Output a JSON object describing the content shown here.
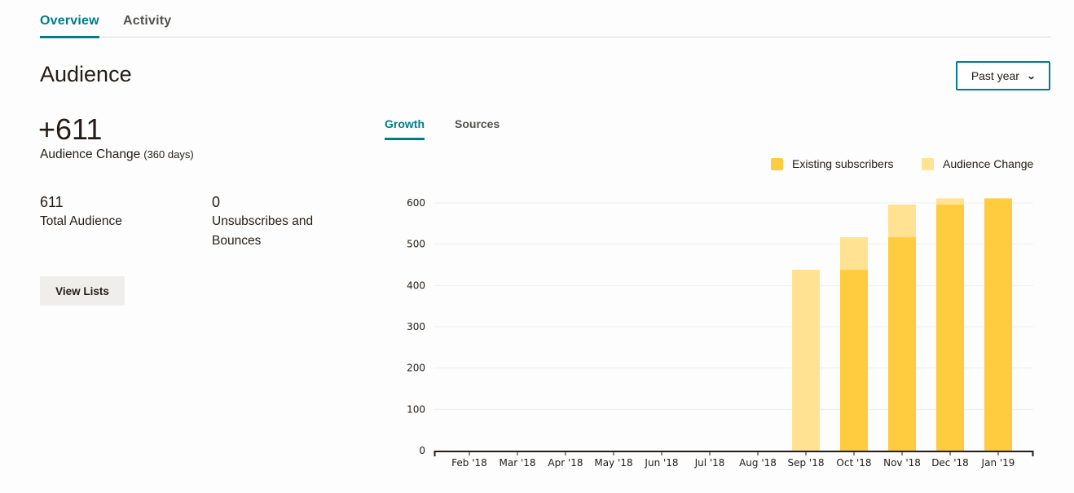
{
  "top_tabs": [
    {
      "label": "Overview",
      "active": true
    },
    {
      "label": "Activity",
      "active": false
    }
  ],
  "page_title": "Audience",
  "range_select": {
    "value": "Past year",
    "icon": "chevron-down-icon"
  },
  "summary": {
    "change_value": "+611",
    "change_label": "Audience Change",
    "change_period": "(360 days)",
    "total_value": "611",
    "total_label": "Total Audience",
    "unsub_value": "0",
    "unsub_label_line1": "Unsubscribes and",
    "unsub_label_line2": "Bounces",
    "view_lists_label": "View Lists"
  },
  "chart_tabs": [
    {
      "label": "Growth",
      "active": true
    },
    {
      "label": "Sources",
      "active": false
    }
  ],
  "colors": {
    "accent": "#007c89",
    "existing": "#ffcc3f",
    "change": "#ffe393"
  },
  "chart_data": {
    "type": "bar",
    "stacked": true,
    "title": "",
    "xlabel": "",
    "ylabel": "",
    "categories": [
      "Feb '18",
      "Mar '18",
      "Apr '18",
      "May '18",
      "Jun '18",
      "Jul '18",
      "Aug '18",
      "Sep '18",
      "Oct '18",
      "Nov '18",
      "Dec '18",
      "Jan '19"
    ],
    "series": [
      {
        "name": "Existing subscribers",
        "color": "#ffcc3f",
        "values": [
          0,
          0,
          0,
          0,
          0,
          0,
          0,
          0,
          438,
          517,
          596,
          611
        ]
      },
      {
        "name": "Audience Change",
        "color": "#ffe393",
        "values": [
          0,
          0,
          0,
          0,
          0,
          0,
          0,
          438,
          79,
          79,
          15,
          0
        ]
      }
    ],
    "ylim": [
      0,
      600
    ],
    "yticks": [
      0,
      100,
      200,
      300,
      400,
      500,
      600
    ],
    "grid": true,
    "legend_position": "top-right"
  }
}
